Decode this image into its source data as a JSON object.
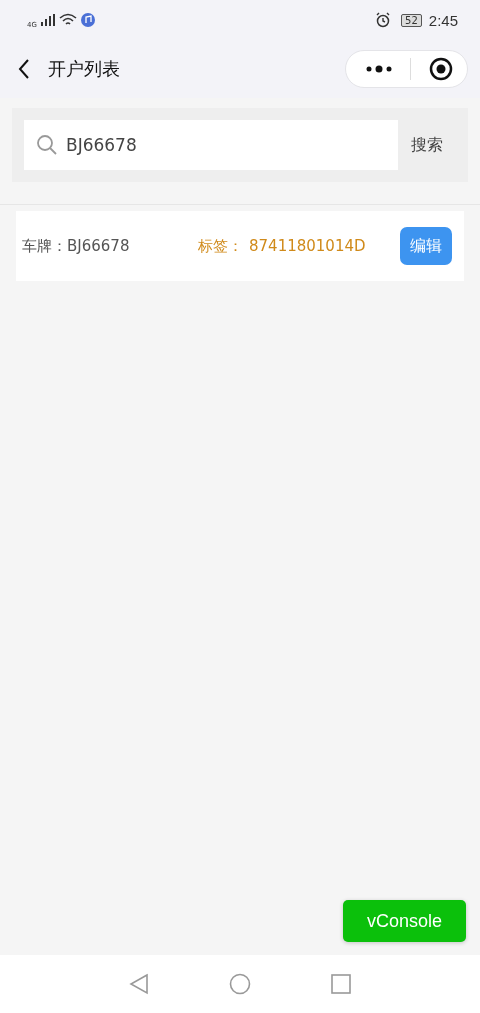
{
  "status_bar": {
    "network": "4G",
    "battery": "52",
    "time": "2:45"
  },
  "nav": {
    "title": "开户列表"
  },
  "search": {
    "value": "BJ66678",
    "button": "搜索"
  },
  "records": [
    {
      "plate": "车牌：BJ66678",
      "tag_label": "标签：",
      "tag": "87411801014D",
      "action": "编辑"
    }
  ],
  "vconsole": "vConsole"
}
